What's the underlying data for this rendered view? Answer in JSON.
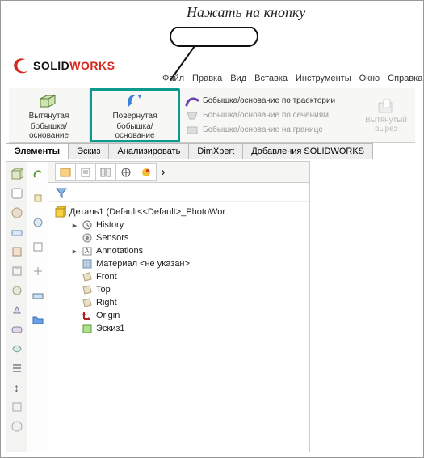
{
  "annotation": "Нажать на кнопку",
  "logo": {
    "solid": "SOLID",
    "works": "WORKS"
  },
  "menu": {
    "file": "Файл",
    "edit": "Правка",
    "view": "Вид",
    "insert": "Вставка",
    "tools": "Инструменты",
    "window": "Окно",
    "help": "Справка"
  },
  "ribbon": {
    "extruded1": "Вытянутая",
    "extruded2": "бобышка/основание",
    "revolved1": "Повернутая",
    "revolved2": "бобышка/основание",
    "swept": "Бобышка/основание по траектории",
    "lofted": "Бобышка/основание по сечениям",
    "boundary": "Бобышка/основание на границе",
    "cut1": "Вытянутый",
    "cut2": "вырез"
  },
  "tabs": {
    "features": "Элементы",
    "sketch": "Эскиз",
    "analyze": "Анализировать",
    "dimxpert": "DimXpert",
    "addins": "Добавления SOLIDWORKS"
  },
  "tree": {
    "root": "Деталь1 (Default<<Default>_PhotoWor",
    "history": "History",
    "sensors": "Sensors",
    "annotations": "Annotations",
    "material": "Материал <не указан>",
    "front": "Front",
    "top": "Top",
    "right": "Right",
    "origin": "Origin",
    "sketch1": "Эскиз1"
  },
  "more": "›"
}
